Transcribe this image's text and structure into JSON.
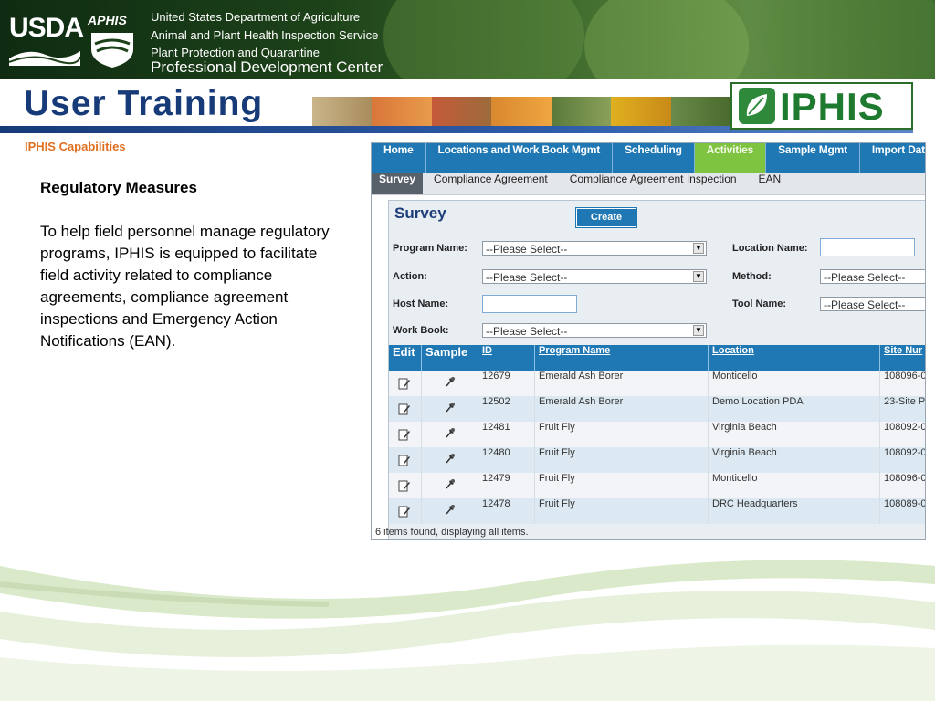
{
  "header": {
    "usda_logo": "USDA",
    "aphis_logo": "APHIS",
    "org_lines": [
      "United States Department of Agriculture",
      "Animal and Plant Health Inspection Service",
      "Plant Protection and Quarantine",
      "Professional Development Center"
    ]
  },
  "banner": {
    "title": "User Training",
    "logo_text": "IPHIS"
  },
  "section_label": "IPHIS Capabilities",
  "content": {
    "heading": "Regulatory Measures",
    "body": "To help field personnel manage regulatory programs, IPHIS is equipped to facilitate field activity related to compliance agreements, compliance agreement inspections and Emergency Action Notifications (EAN)."
  },
  "app": {
    "nav_tabs": [
      "Home",
      "Locations and Work Book Mgmt",
      "Scheduling",
      "Activities",
      "Sample Mgmt",
      "Import Dat"
    ],
    "active_nav": "Activities",
    "sub_tabs": [
      "Survey",
      "Compliance Agreement",
      "Compliance Agreement Inspection",
      "EAN"
    ],
    "active_sub": "Survey",
    "panel_title": "Survey",
    "create_label": "Create",
    "form": {
      "program_name_label": "Program Name:",
      "program_name_value": "--Please Select--",
      "action_label": "Action:",
      "action_value": "--Please Select--",
      "host_name_label": "Host Name:",
      "work_book_label": "Work Book:",
      "work_book_value": "--Please Select--",
      "location_name_label": "Location Name:",
      "method_label": "Method:",
      "method_value": "--Please Select--",
      "tool_name_label": "Tool Name:",
      "tool_name_value": "--Please Select--"
    },
    "table": {
      "columns": [
        "Edit",
        "Sample",
        "ID",
        "Program Name",
        "Location",
        "Site Nur"
      ],
      "rows": [
        {
          "id": "12679",
          "program": "Emerald Ash Borer",
          "location": "Monticello",
          "site": "108096-0"
        },
        {
          "id": "12502",
          "program": "Emerald Ash Borer",
          "location": "Demo Location PDA",
          "site": "23-Site P"
        },
        {
          "id": "12481",
          "program": "Fruit Fly",
          "location": "Virginia Beach",
          "site": "108092-0"
        },
        {
          "id": "12480",
          "program": "Fruit Fly",
          "location": "Virginia Beach",
          "site": "108092-0"
        },
        {
          "id": "12479",
          "program": "Fruit Fly",
          "location": "Monticello",
          "site": "108096-0"
        },
        {
          "id": "12478",
          "program": "Fruit Fly",
          "location": "DRC Headquarters",
          "site": "108089-0"
        }
      ],
      "footer": "6 items found, displaying all items."
    }
  },
  "colors": {
    "nav_blue": "#1f78b4",
    "active_green": "#7fc441",
    "title_navy": "#173a78",
    "accent_orange": "#e07020"
  }
}
